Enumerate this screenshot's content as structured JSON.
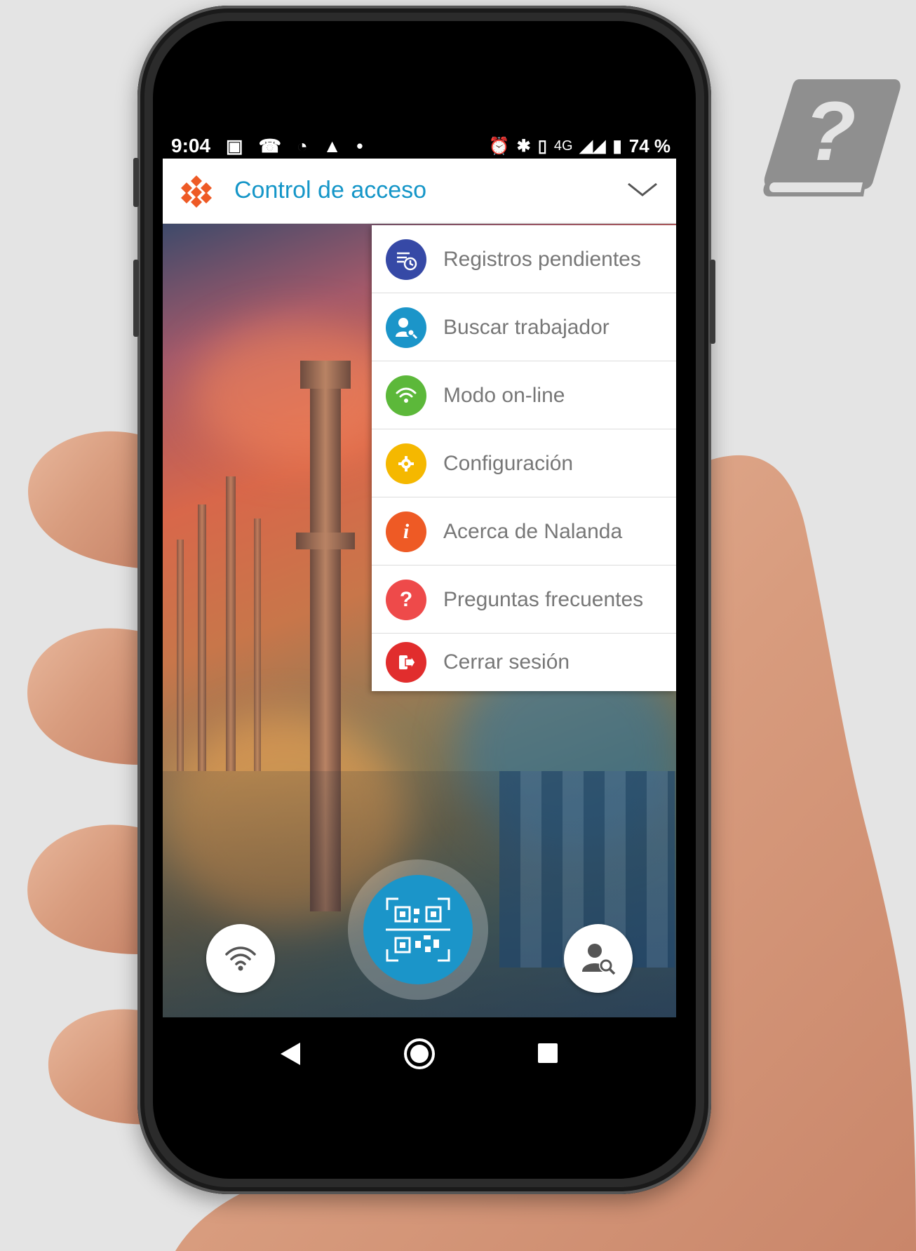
{
  "statusbar": {
    "time": "9:04",
    "network": "4G",
    "battery": "74 %"
  },
  "appbar": {
    "title": "Control de acceso"
  },
  "menu": {
    "items": [
      {
        "label": "Registros pendientes",
        "icon": "pending-records-icon",
        "color": "#3649a6"
      },
      {
        "label": "Buscar trabajador",
        "icon": "search-worker-icon",
        "color": "#1b95c9"
      },
      {
        "label": "Modo on-line",
        "icon": "wifi-icon",
        "color": "#5cb83a"
      },
      {
        "label": "Configuración",
        "icon": "gear-icon",
        "color": "#f5b800"
      },
      {
        "label": "Acerca de Nalanda",
        "icon": "info-icon",
        "color": "#ee5a25"
      },
      {
        "label": "Preguntas frecuentes",
        "icon": "question-icon",
        "color": "#ee4a4a"
      },
      {
        "label": "Cerrar sesión",
        "icon": "logout-icon",
        "color": "#e12d2d"
      }
    ]
  },
  "fabs": {
    "left": "wifi-icon",
    "center": "qr-scan-icon",
    "right": "search-worker-icon"
  },
  "colors": {
    "accent": "#1596c8",
    "logo": "#ee5a25"
  }
}
